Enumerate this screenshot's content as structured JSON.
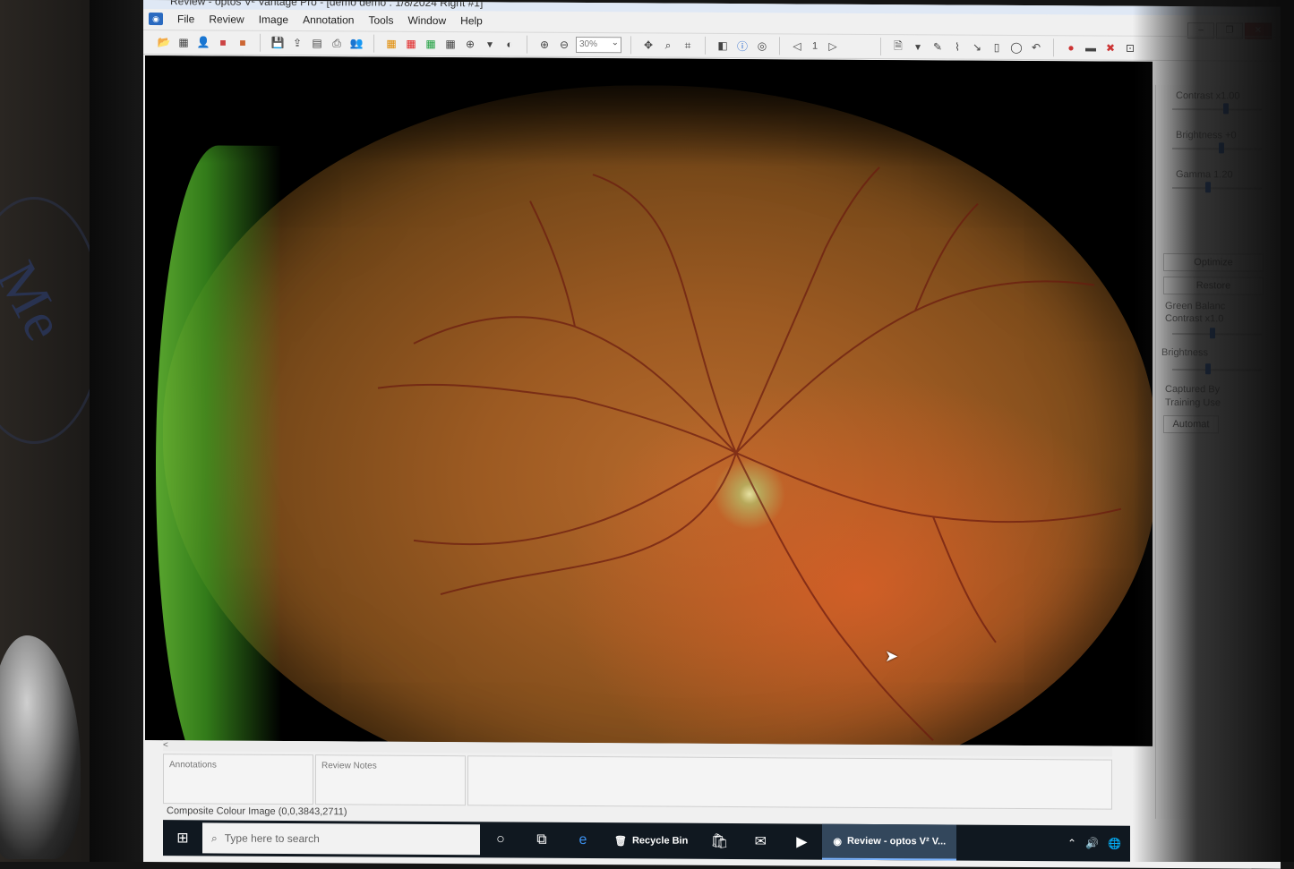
{
  "window": {
    "title": "Review - optos V² Vantage Pro - [demo demo : 1/8/2024 Right #1]",
    "controls": [
      "minimize",
      "restore",
      "close"
    ]
  },
  "menu": [
    "File",
    "Review",
    "Image",
    "Annotation",
    "Tools",
    "Window",
    "Help"
  ],
  "toolbar": {
    "zoom_value": "30%",
    "page_number": "1"
  },
  "image_adjust": {
    "contrast_label": "Contrast  x1.00",
    "contrast_level": 0.6,
    "brightness_label": "Brightness  +0",
    "brightness_level": 0.55,
    "gamma_label": "Gamma  1.20",
    "gamma_level": 0.4,
    "optimize_button": "Optimize",
    "restore_button": "Restore",
    "green_balance_label": "Green Balanc",
    "green_contrast_label": "Contrast  x1.0",
    "green_contrast_level": 0.45,
    "green_brightness_label": "Brightness",
    "green_brightness_level": 0.4,
    "captured_by_label": "Captured By",
    "training_user_label": "Training Use",
    "automatic_label": "Automat"
  },
  "bottom": {
    "annotations_label": "Annotations",
    "review_notes_label": "Review Notes"
  },
  "status_bar": "Composite Colour Image (0,0,3843,2711)",
  "taskbar": {
    "search_placeholder": "Type here to search",
    "recycle_bin": "Recycle Bin",
    "active_app": "Review - optos V² V..."
  },
  "colors": {
    "accent": "#2a6ad0",
    "taskbar": "#101820"
  }
}
